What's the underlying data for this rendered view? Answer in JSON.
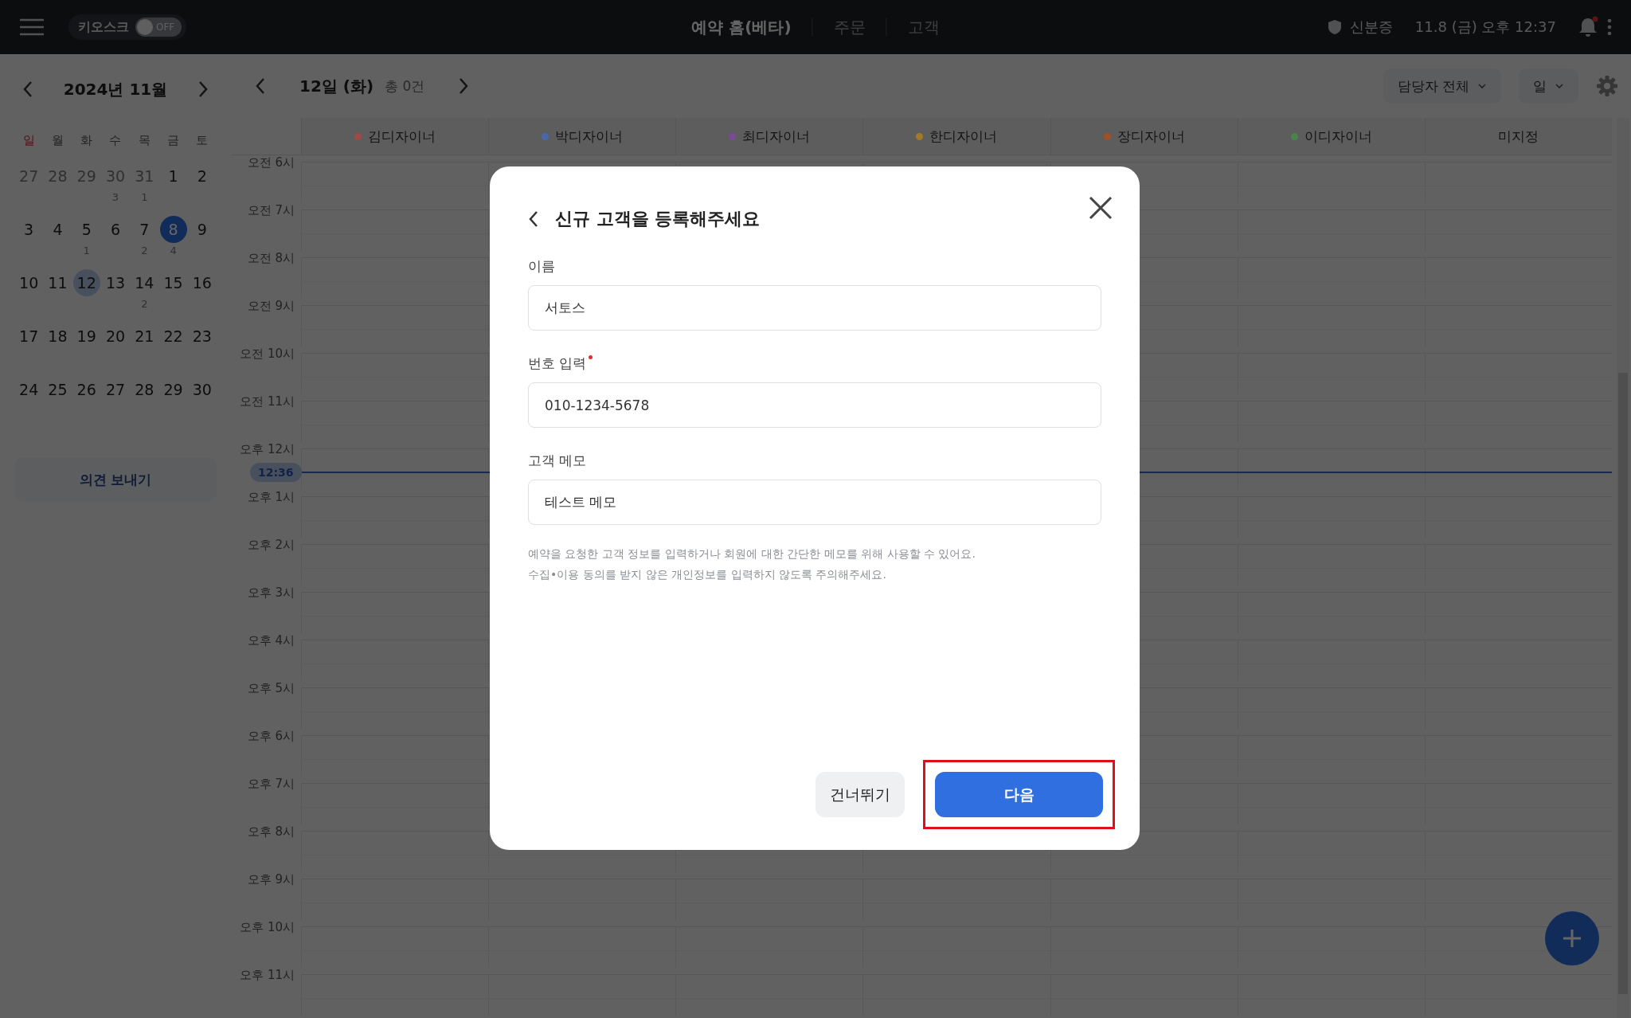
{
  "top_bar": {
    "kiosk": {
      "label": "키오스크",
      "state_text": "OFF",
      "on": false
    },
    "tabs": [
      {
        "label": "예약 홈(베타)",
        "selected": true
      },
      {
        "label": "주문",
        "selected": false
      },
      {
        "label": "고객",
        "selected": false
      }
    ],
    "id_label": "신분증",
    "datetime": "11.8 (금) 오후 12:37",
    "has_notification": true
  },
  "calendar": {
    "month": "2024년 11월",
    "weekdays": [
      {
        "label": "일",
        "sunday": true
      },
      {
        "label": "월",
        "sunday": false
      },
      {
        "label": "화",
        "sunday": false
      },
      {
        "label": "수",
        "sunday": false
      },
      {
        "label": "목",
        "sunday": false
      },
      {
        "label": "금",
        "sunday": false
      },
      {
        "label": "토",
        "sunday": false
      }
    ],
    "days": [
      {
        "day": "27",
        "outside": true,
        "selected": false,
        "today": false
      },
      {
        "day": "28",
        "outside": true,
        "selected": false,
        "today": false
      },
      {
        "day": "29",
        "outside": true,
        "selected": false,
        "today": false
      },
      {
        "day": "30",
        "outside": true,
        "selected": false,
        "today": false,
        "count": "3"
      },
      {
        "day": "31",
        "outside": true,
        "selected": false,
        "today": false,
        "count": "1"
      },
      {
        "day": "1",
        "outside": false,
        "selected": false,
        "today": false
      },
      {
        "day": "2",
        "outside": false,
        "selected": false,
        "today": false
      },
      {
        "day": "3",
        "outside": false,
        "selected": false,
        "today": false
      },
      {
        "day": "4",
        "outside": false,
        "selected": false,
        "today": false
      },
      {
        "day": "5",
        "outside": false,
        "selected": false,
        "today": false,
        "count": "1"
      },
      {
        "day": "6",
        "outside": false,
        "selected": false,
        "today": false
      },
      {
        "day": "7",
        "outside": false,
        "selected": false,
        "today": false,
        "count": "2"
      },
      {
        "day": "8",
        "outside": false,
        "selected": true,
        "today": false,
        "count": "4"
      },
      {
        "day": "9",
        "outside": false,
        "selected": false,
        "today": false
      },
      {
        "day": "10",
        "outside": false,
        "selected": false,
        "today": false
      },
      {
        "day": "11",
        "outside": false,
        "selected": false,
        "today": false
      },
      {
        "day": "12",
        "outside": false,
        "selected": false,
        "today": true
      },
      {
        "day": "13",
        "outside": false,
        "selected": false,
        "today": false
      },
      {
        "day": "14",
        "outside": false,
        "selected": false,
        "today": false,
        "count": "2"
      },
      {
        "day": "15",
        "outside": false,
        "selected": false,
        "today": false
      },
      {
        "day": "16",
        "outside": false,
        "selected": false,
        "today": false
      },
      {
        "day": "17",
        "outside": false,
        "selected": false,
        "today": false
      },
      {
        "day": "18",
        "outside": false,
        "selected": false,
        "today": false
      },
      {
        "day": "19",
        "outside": false,
        "selected": false,
        "today": false
      },
      {
        "day": "20",
        "outside": false,
        "selected": false,
        "today": false
      },
      {
        "day": "21",
        "outside": false,
        "selected": false,
        "today": false
      },
      {
        "day": "22",
        "outside": false,
        "selected": false,
        "today": false
      },
      {
        "day": "23",
        "outside": false,
        "selected": false,
        "today": false
      },
      {
        "day": "24",
        "outside": false,
        "selected": false,
        "today": false
      },
      {
        "day": "25",
        "outside": false,
        "selected": false,
        "today": false
      },
      {
        "day": "26",
        "outside": false,
        "selected": false,
        "today": false
      },
      {
        "day": "27",
        "outside": false,
        "selected": false,
        "today": false
      },
      {
        "day": "28",
        "outside": false,
        "selected": false,
        "today": false
      },
      {
        "day": "29",
        "outside": false,
        "selected": false,
        "today": false
      },
      {
        "day": "30",
        "outside": false,
        "selected": false,
        "today": false
      }
    ],
    "feedback_button": "의견 보내기"
  },
  "schedule": {
    "date": "12일 (화)",
    "total": "총 0건",
    "staff_filter": "담당자 전체",
    "view": "일",
    "columns": [
      {
        "name": "김디자이너",
        "color": "#a04848"
      },
      {
        "name": "박디자이너",
        "color": "#4a68a8"
      },
      {
        "name": "최디자이너",
        "color": "#7a4a98"
      },
      {
        "name": "한디자이너",
        "color": "#a07a28"
      },
      {
        "name": "장디자이너",
        "color": "#a05028"
      },
      {
        "name": "이디자이너",
        "color": "#4a844a"
      },
      {
        "name": "미지정"
      }
    ],
    "hours": [
      "오전 6시",
      "오전 7시",
      "오전 8시",
      "오전 9시",
      "오전 10시",
      "오전 11시",
      "오후 12시",
      "오후 1시",
      "오후 2시",
      "오후 3시",
      "오후 4시",
      "오후 5시",
      "오후 6시",
      "오후 7시",
      "오후 8시",
      "오후 9시",
      "오후 10시",
      "오후 11시"
    ],
    "now_label": "12:36"
  },
  "modal": {
    "title": "신규 고객을 등록해주세요",
    "fields": [
      {
        "label": "이름",
        "value": "서토스",
        "required": false
      },
      {
        "label": "번호 입력",
        "value": "010-1234-5678",
        "required": true
      },
      {
        "label": "고객 메모",
        "value": "테스트 메모",
        "required": false
      }
    ],
    "help": [
      "예약을 요청한 고객 정보를 입력하거나 회원에 대한 간단한 메모를 위해 사용할 수 있어요.",
      "수집•이용 동의를 받지 않은 개인정보를 입력하지 않도록 주의해주세요."
    ],
    "buttons": [
      {
        "label": "건너뛰기",
        "kind": "secondary",
        "highlighted": false
      },
      {
        "label": "다음",
        "kind": "primary",
        "highlighted": true
      }
    ]
  }
}
